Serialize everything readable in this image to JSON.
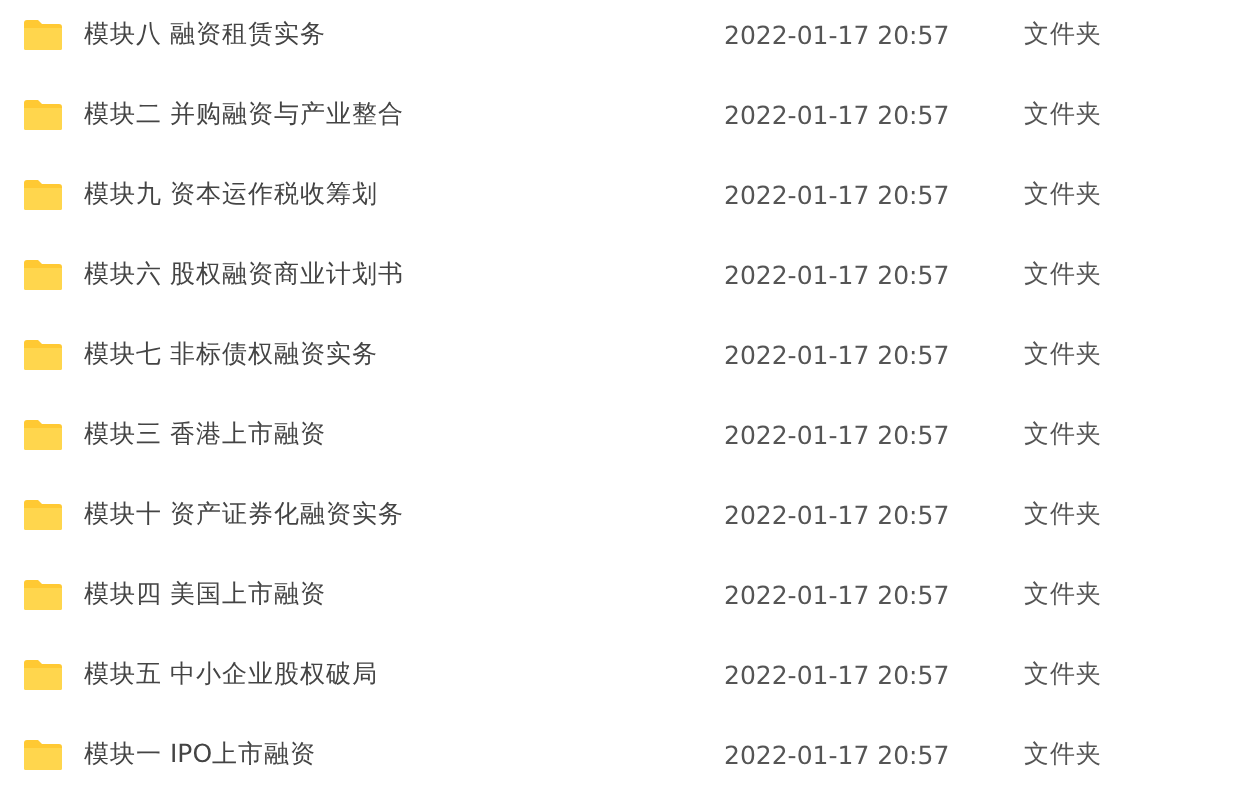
{
  "files": [
    {
      "name": "模块八 融资租赁实务",
      "modified": "2022-01-17 20:57",
      "type": "文件夹"
    },
    {
      "name": "模块二 并购融资与产业整合",
      "modified": "2022-01-17 20:57",
      "type": "文件夹"
    },
    {
      "name": "模块九 资本运作税收筹划",
      "modified": "2022-01-17 20:57",
      "type": "文件夹"
    },
    {
      "name": "模块六 股权融资商业计划书",
      "modified": "2022-01-17 20:57",
      "type": "文件夹"
    },
    {
      "name": "模块七 非标债权融资实务",
      "modified": "2022-01-17 20:57",
      "type": "文件夹"
    },
    {
      "name": "模块三 香港上市融资",
      "modified": "2022-01-17 20:57",
      "type": "文件夹"
    },
    {
      "name": "模块十 资产证券化融资实务",
      "modified": "2022-01-17 20:57",
      "type": "文件夹"
    },
    {
      "name": "模块四 美国上市融资",
      "modified": "2022-01-17 20:57",
      "type": "文件夹"
    },
    {
      "name": "模块五 中小企业股权破局",
      "modified": "2022-01-17 20:57",
      "type": "文件夹"
    },
    {
      "name": "模块一 IPO上市融资",
      "modified": "2022-01-17 20:57",
      "type": "文件夹"
    }
  ]
}
